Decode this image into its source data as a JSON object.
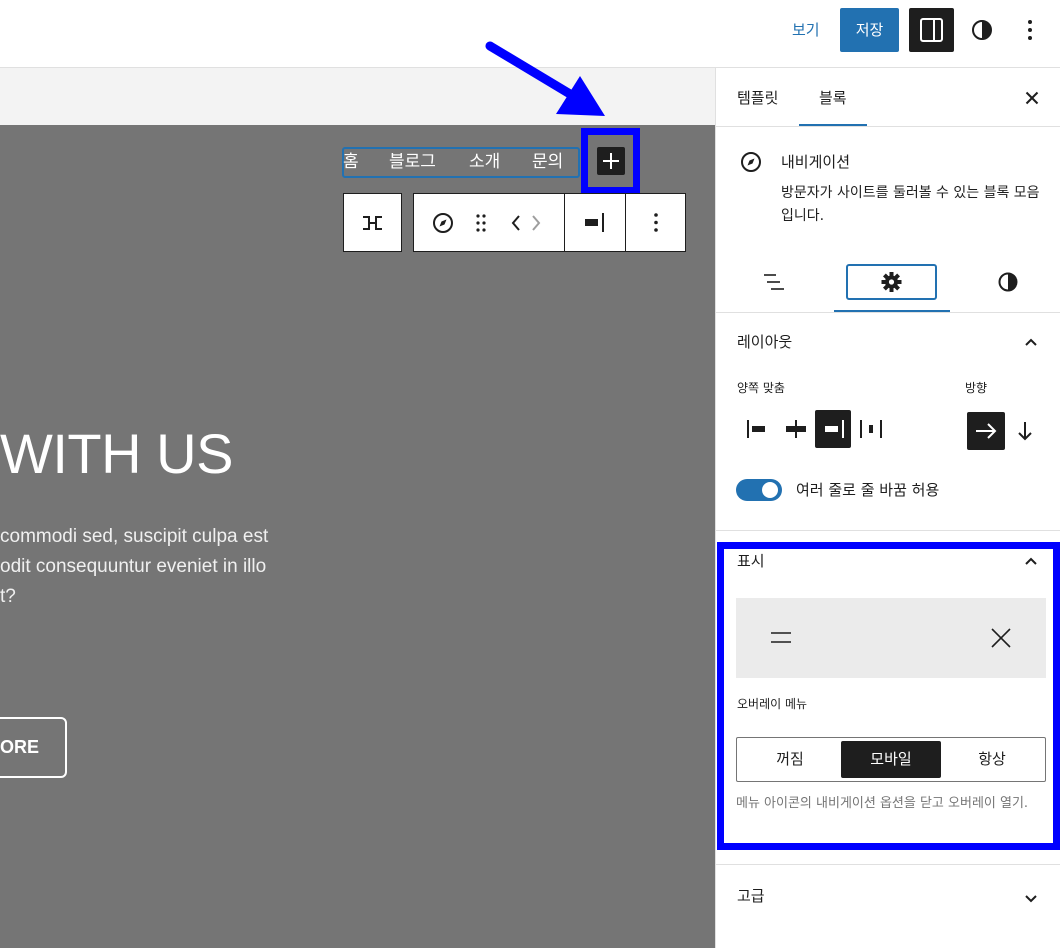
{
  "topbar": {
    "view_label": "보기",
    "save_label": "저장"
  },
  "canvas": {
    "nav_items": [
      "홈",
      "블로그",
      "소개",
      "문의"
    ],
    "hero_heading": "WITH US",
    "hero_lines": [
      "commodi sed, suscipit culpa est",
      "odit consequuntur eveniet in illo",
      "t?"
    ],
    "hero_button": "ORE"
  },
  "sidebar": {
    "tabs": [
      "템플릿",
      "블록"
    ],
    "active_tab": "블록",
    "block_card": {
      "title": "내비게이션",
      "description": "방문자가 사이트를 둘러볼 수 있는 블록 모음입니다."
    },
    "layout_panel": {
      "title": "레이아웃",
      "justify_label": "양쪽 맞춤",
      "direction_label": "방향",
      "wrap_label": "여러 줄로 줄 바꿈 허용",
      "wrap_enabled": true
    },
    "display_panel": {
      "title": "표시",
      "overlay_label": "오버레이 메뉴",
      "options": [
        "꺼짐",
        "모바일",
        "항상"
      ],
      "selected": "모바일",
      "help": "메뉴 아이콘의 내비게이션 옵션을 닫고 오버레이 열기."
    },
    "advanced_panel": {
      "title": "고급"
    }
  },
  "colors": {
    "accent": "#2271b1",
    "highlight": "#0000ff",
    "canvas_bg": "#757575",
    "dark": "#1e1e1e"
  }
}
